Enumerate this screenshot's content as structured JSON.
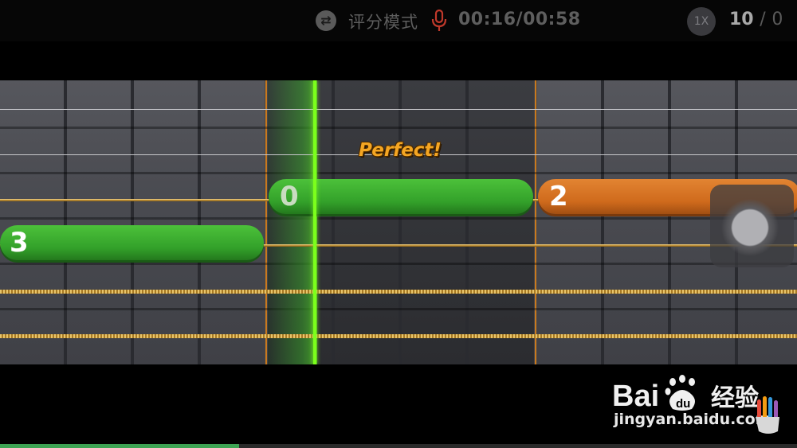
{
  "topbar": {
    "mode_icon": "swap-arrows-icon",
    "mode_label": "评分模式",
    "mic_icon": "microphone-icon",
    "mic_color": "#c0392b",
    "timer": "00:16/00:58",
    "speed": "1X",
    "score_current": "10",
    "score_separator": "/",
    "score_total": "0"
  },
  "board": {
    "playhead_color": "#7cff1c",
    "feedback": "Perfect!",
    "notes": [
      {
        "fret": "3",
        "color": "green"
      },
      {
        "fret": "0",
        "color": "green"
      },
      {
        "fret": "2",
        "color": "orange"
      }
    ]
  },
  "watermark": {
    "brand": "Bai",
    "brand_suffix": "du",
    "product": "经验",
    "url": "jingyan.baidu.com"
  },
  "progress": {
    "fraction": 0.3,
    "color": "#3da353"
  }
}
